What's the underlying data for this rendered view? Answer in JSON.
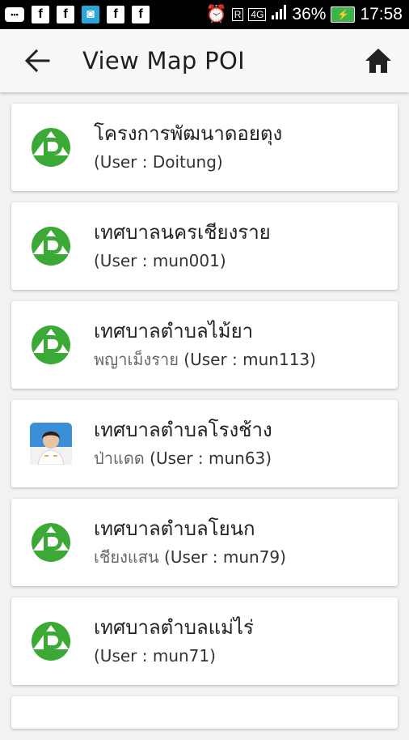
{
  "statusbar": {
    "icons": [
      "facebook-icon",
      "facebook-icon",
      "chat-icon",
      "facebook-icon",
      "facebook-icon",
      "alarm-icon",
      "r-icon",
      "4g-icon",
      "signal-icon"
    ],
    "network_label": "4G",
    "battery_percent": "36%",
    "time": "17:58"
  },
  "appbar": {
    "title": "View Map POI",
    "back_icon": "arrow-left-icon",
    "home_icon": "home-icon"
  },
  "colors": {
    "logo_green": "#3aa935",
    "title_text": "#1f1f1f"
  },
  "items": [
    {
      "name": "โครงการพัฒนาดอยตุง",
      "area": "",
      "user": "(User : Doitung)",
      "avatar": "logo"
    },
    {
      "name": "เทศบาลนครเชียงราย",
      "area": "",
      "user": "(User : mun001)",
      "avatar": "logo"
    },
    {
      "name": "เทศบาลตำบลไม้ยา",
      "area": "พญาเม็งราย ",
      "user": "(User : mun113)",
      "avatar": "logo"
    },
    {
      "name": "เทศบาลตำบลโรงช้าง",
      "area": "ป่าแดด ",
      "user": "(User : mun63)",
      "avatar": "photo"
    },
    {
      "name": "เทศบาลตำบลโยนก",
      "area": "เชียงแสน ",
      "user": "(User : mun79)",
      "avatar": "logo"
    },
    {
      "name": "เทศบาลตำบลแม่ไร่",
      "area": "",
      "user": "(User : mun71)",
      "avatar": "logo"
    }
  ]
}
